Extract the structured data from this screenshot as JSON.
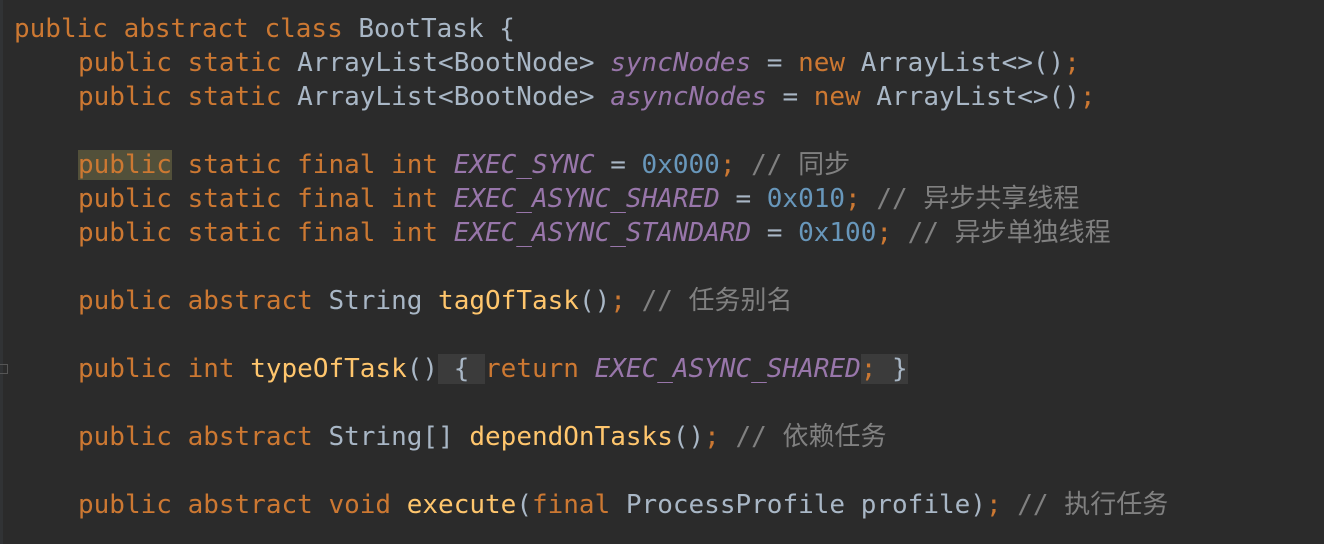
{
  "editor": {
    "class_decl": {
      "kw": "public abstract class",
      "name": "BootTask",
      "brace": "{"
    },
    "sync_nodes": {
      "kw": "public static",
      "type": "ArrayList<BootNode>",
      "name": "syncNodes",
      "eq": "=",
      "new": "new",
      "init": "ArrayList<>()",
      "semi": ";"
    },
    "async_nodes": {
      "kw": "public static",
      "type": "ArrayList<BootNode>",
      "name": "asyncNodes",
      "eq": "=",
      "new": "new",
      "init": "ArrayList<>()",
      "semi": ";"
    },
    "exec_sync": {
      "kw_public": "public",
      "kw": "static final int",
      "name": "EXEC_SYNC",
      "eq": "=",
      "value": "0x000",
      "semi": ";",
      "comment": "// 同步"
    },
    "exec_async_shared": {
      "kw": "public static final int",
      "name": "EXEC_ASYNC_SHARED",
      "eq": "=",
      "value": "0x010",
      "semi": ";",
      "comment": "// 异步共享线程"
    },
    "exec_async_standard": {
      "kw": "public static final int",
      "name": "EXEC_ASYNC_STANDARD",
      "eq": "=",
      "value": "0x100",
      "semi": ";",
      "comment": "// 异步单独线程"
    },
    "tag_of_task": {
      "kw": "public abstract",
      "type": "String",
      "name": "tagOfTask",
      "parens": "()",
      "semi": ";",
      "comment": "// 任务别名"
    },
    "type_of_task": {
      "kw": "public int",
      "name": "typeOfTask",
      "parens": "()",
      "open": "{",
      "ret": "return",
      "value": "EXEC_ASYNC_SHARED",
      "semi": ";",
      "close": "}"
    },
    "depend_on_tasks": {
      "kw": "public abstract",
      "type": "String[]",
      "name": "dependOnTasks",
      "parens": "()",
      "semi": ";",
      "comment": "// 依赖任务"
    },
    "execute": {
      "kw": "public abstract void",
      "name": "execute",
      "open_paren": "(",
      "final": "final",
      "params": "ProcessProfile profile)",
      "semi": ";",
      "comment": "// 执行任务"
    }
  }
}
